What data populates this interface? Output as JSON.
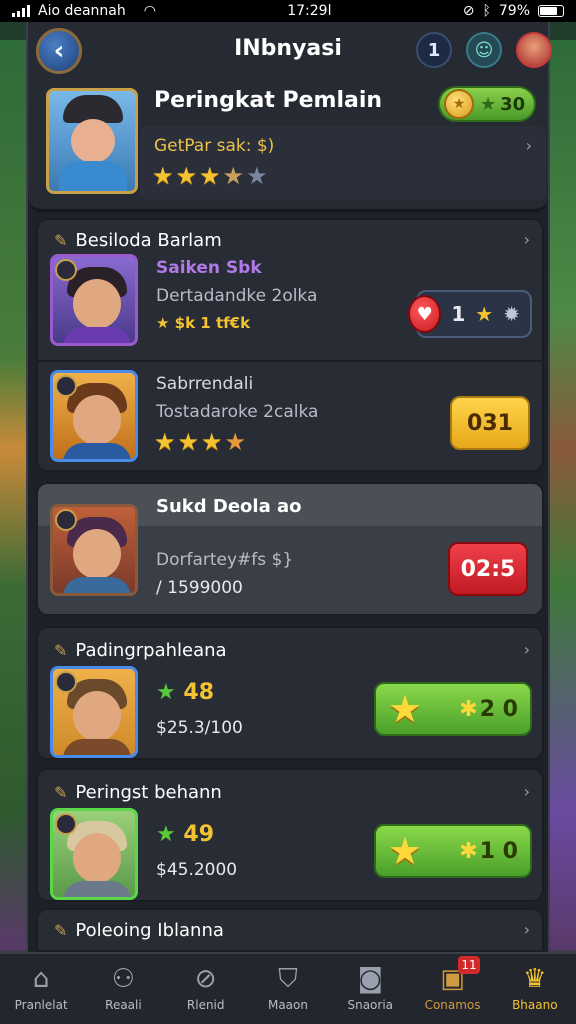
{
  "status_bar": {
    "carrier": "Aio deannah",
    "time": "17:29l",
    "battery": "79%",
    "battery_level": 0.79
  },
  "header": {
    "title": "INbnyasi",
    "notification_count": "1",
    "profile_title": "Peringkat Pemlain",
    "coins": "30",
    "sub_label": "GetPar sak: $)",
    "rating": "3.5"
  },
  "sections": [
    {
      "title": "Besiloda Barlam",
      "rows": [
        {
          "name": "Saiken Sbk",
          "subtitle": "Dertadandke 2olka",
          "extra": "★ $k 1 tf€k",
          "score": "1"
        },
        {
          "name": "Sabrrendali",
          "subtitle": "Tostadaroke 2calka",
          "score": "031",
          "rating": "3.5"
        }
      ]
    },
    {
      "title": "Sukd Deola ao",
      "rows": [
        {
          "subtitle": "Dorfartey#fs $}",
          "amount": "/ 1599000",
          "score": "02:5"
        }
      ]
    },
    {
      "title": "Padingrpahleana",
      "rows": [
        {
          "points": "48",
          "amount": "$25.3/100",
          "score": "2 0"
        }
      ]
    },
    {
      "title": "Peringst behann",
      "rows": [
        {
          "points": "49",
          "amount": "$45.2000",
          "score": "1 0"
        }
      ]
    },
    {
      "title": "Poleoing Iblanna"
    }
  ],
  "bottom_nav": [
    {
      "label": "Pranlelat",
      "icon": "home-icon"
    },
    {
      "label": "Reaali",
      "icon": "team-icon"
    },
    {
      "label": "Rlenid",
      "icon": "compass-icon"
    },
    {
      "label": "Maaon",
      "icon": "shield-icon"
    },
    {
      "label": "Snaoria",
      "icon": "camera-icon"
    },
    {
      "label": "Conamos",
      "icon": "chat-icon",
      "badge": "11"
    },
    {
      "label": "Bhaano",
      "icon": "crown-icon"
    }
  ]
}
